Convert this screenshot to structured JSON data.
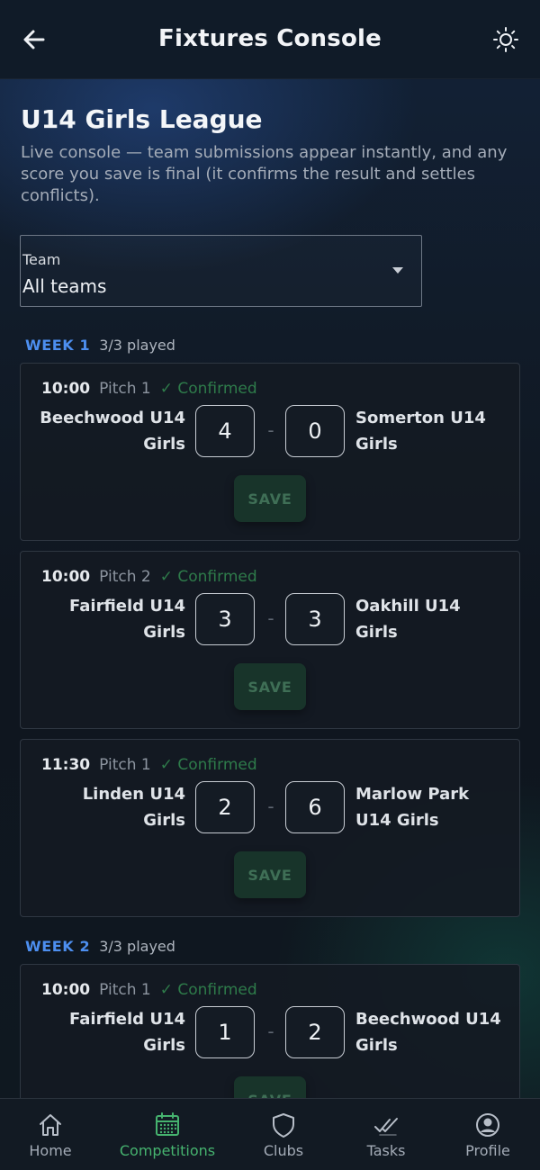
{
  "header": {
    "title": "Fixtures Console",
    "back_icon": "arrow-left-icon",
    "theme_icon": "sun-icon"
  },
  "league": {
    "title": "U14 Girls League",
    "description": "Live console — team submissions appear instantly, and any score you save is final (it confirms the result and settles conflicts)."
  },
  "filter": {
    "label": "Team",
    "value": "All teams"
  },
  "weeks": [
    {
      "label": "WEEK 1",
      "played": "3/3 played",
      "fixtures": [
        {
          "time": "10:00",
          "pitch": "Pitch 1",
          "status": "✓ Confirmed",
          "home": "Beechwood U14 Girls",
          "away": "Somerton U14 Girls",
          "home_score": "4",
          "away_score": "0",
          "separator": "-",
          "save_label": "SAVE"
        },
        {
          "time": "10:00",
          "pitch": "Pitch 2",
          "status": "✓ Confirmed",
          "home": "Fairfield U14 Girls",
          "away": "Oakhill U14 Girls",
          "home_score": "3",
          "away_score": "3",
          "separator": "-",
          "save_label": "SAVE"
        },
        {
          "time": "11:30",
          "pitch": "Pitch 1",
          "status": "✓ Confirmed",
          "home": "Linden U14 Girls",
          "away": "Marlow Park U14 Girls",
          "home_score": "2",
          "away_score": "6",
          "separator": "-",
          "save_label": "SAVE"
        }
      ]
    },
    {
      "label": "WEEK 2",
      "played": "3/3 played",
      "fixtures": [
        {
          "time": "10:00",
          "pitch": "Pitch 1",
          "status": "✓ Confirmed",
          "home": "Fairfield U14 Girls",
          "away": "Beechwood U14 Girls",
          "home_score": "1",
          "away_score": "2",
          "separator": "-",
          "save_label": "SAVE"
        }
      ]
    }
  ],
  "nav": {
    "items": [
      {
        "label": "Home",
        "icon": "home-icon"
      },
      {
        "label": "Competitions",
        "icon": "calendar-icon",
        "active": true
      },
      {
        "label": "Clubs",
        "icon": "shield-icon"
      },
      {
        "label": "Tasks",
        "icon": "double-check-icon"
      },
      {
        "label": "Profile",
        "icon": "user-circle-icon"
      }
    ]
  },
  "colors": {
    "accent_blue": "#4d8ff0",
    "accent_green": "#46b36f",
    "confirmed_green": "#2e7b4a",
    "save_bg": "#18342a"
  }
}
